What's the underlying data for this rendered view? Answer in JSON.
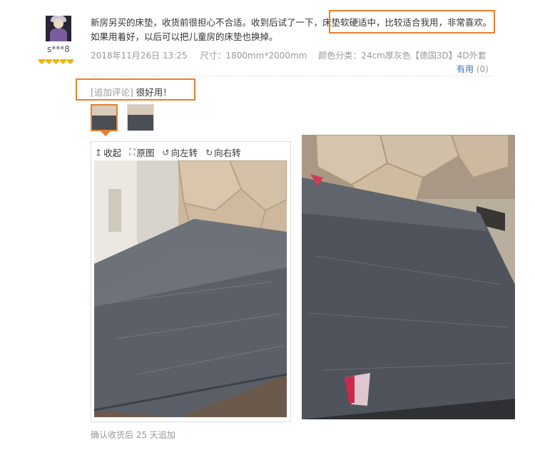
{
  "user": {
    "name": "s***8",
    "rank_icons": 5
  },
  "review": {
    "text": "新房另买的床垫，收货前很担心不合适。收到后试了一下，床垫软硬适中，比较适合我用，非常喜欢。如果用着好，以后可以把儿童房的床垫也换掉。",
    "date": "2018年11月26日 13:25",
    "size": "尺寸：1800mm*2000mm",
    "color": "颜色分类：24cm厚灰色【德国3D】4D外套",
    "useful_label": "有用",
    "useful_count": "(0)"
  },
  "append": {
    "tag": "[追加评论]",
    "text": "很好用！"
  },
  "viewer": {
    "collapse_label": "收起",
    "original_label": "原图",
    "rotate_left_label": "向左转",
    "rotate_right_label": "向右转"
  },
  "footer": {
    "text": "确认收货后 25 天追加"
  },
  "colors": {
    "accent": "#e8802a",
    "link": "#3c6fb6",
    "muted": "#999999"
  }
}
